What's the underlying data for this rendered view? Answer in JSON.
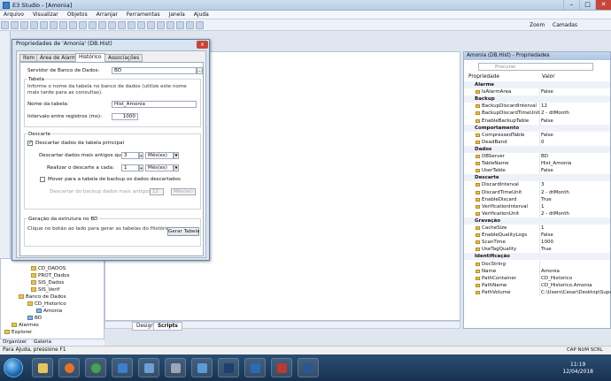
{
  "window": {
    "title": "E3 Studio - [Amonia]"
  },
  "menu": [
    "Arquivo",
    "Visualizar",
    "Objetos",
    "Arranjar",
    "Ferramentas",
    "Janela",
    "Ajuda"
  ],
  "toolbar": {
    "zoom_label": "Zoom",
    "camadas_label": "Camadas"
  },
  "dialog": {
    "title": "Propriedades de 'Amonia' (DB.Hist)",
    "close": "x",
    "tabs": [
      "Item",
      "Área de Alarmes",
      "Histórico",
      "Associações"
    ],
    "server_label": "Servidor de Banco de Dados:",
    "server_value": "BD",
    "browse_btn": "...",
    "tabela_group": "Tabela",
    "tabela_desc": "Informe o nome da tabela no banco de dados (utilize este nome mais tarde para as consultas).",
    "table_name_label": "Nome da tabela:",
    "table_name_value": "Hist_Amonia",
    "interval_label": "Intervalo entre registros (ms):",
    "interval_value": "1000",
    "descarte_group": "Descarte",
    "discard_check": "Descartar dados da tabela principal",
    "discard_older_label": "Descartar dados mais antigos que:",
    "discard_older_value": "3",
    "discard_older_unit": "Mês(es)",
    "discard_each_label": "Realizar o descarte a cada:",
    "discard_each_value": "1",
    "discard_each_unit": "Mês(es)",
    "move_check": "Mover para a tabela de backup os dados descartados",
    "backup_older_label": "Descartar do backup dados mais antigos que:",
    "backup_older_value": "12",
    "backup_older_unit": "Mês(es)",
    "gen_group": "Geração da estrutura no BD",
    "gen_desc": "Clique no botão ao lado para gerar as tabelas do Histórico",
    "gen_btn": "Gerar Tabela"
  },
  "tree": {
    "items": [
      "CD_DADOS",
      "PROT_Dados",
      "SIS_Dados",
      "SIS_Verif",
      "Banco de Dados",
      "CD_Historico",
      "Amonia",
      "BD",
      "Alarmes",
      "Explorer"
    ]
  },
  "left_bottom_tabs": [
    "Organizer",
    "Galeria"
  ],
  "editor_tabs": [
    "Design",
    "Scripts"
  ],
  "properties": {
    "title": "Amonia (DB.Hist) - Propriedades",
    "search_placeholder": "Procurar",
    "col_prop": "Propriedade",
    "col_val": "Valor",
    "rows": [
      {
        "cat": true,
        "name": "Alarme"
      },
      {
        "name": "IsAlarmArea",
        "value": "False"
      },
      {
        "cat": true,
        "name": "Backup"
      },
      {
        "name": "BackupDiscardInterval",
        "value": "12"
      },
      {
        "name": "BackupDiscardTimeUnit",
        "value": "2 - dtMonth"
      },
      {
        "name": "EnableBackupTable",
        "value": "False"
      },
      {
        "cat": true,
        "name": "Comportamento"
      },
      {
        "name": "CompressedTable",
        "value": "False"
      },
      {
        "name": "DeadBand",
        "value": "0"
      },
      {
        "cat": true,
        "name": "Dados"
      },
      {
        "name": "DBServer",
        "value": "BD"
      },
      {
        "name": "TableName",
        "value": "Hist_Amonia"
      },
      {
        "name": "UserTable",
        "value": "False"
      },
      {
        "cat": true,
        "name": "Descarte"
      },
      {
        "name": "DiscardInterval",
        "value": "3"
      },
      {
        "name": "DiscardTimeUnit",
        "value": "2 - dtMonth"
      },
      {
        "name": "EnableDiscard",
        "value": "True"
      },
      {
        "name": "VerificationInterval",
        "value": "1"
      },
      {
        "name": "VerificationUnit",
        "value": "2 - dtMonth"
      },
      {
        "cat": true,
        "name": "Gravação"
      },
      {
        "name": "CacheSize",
        "value": "1"
      },
      {
        "name": "EnableQualityLogs",
        "value": "False"
      },
      {
        "name": "ScanTime",
        "value": "1000"
      },
      {
        "name": "UseTagQuality",
        "value": "True"
      },
      {
        "cat": true,
        "name": "Identificação"
      },
      {
        "name": "DocString",
        "value": ""
      },
      {
        "name": "Name",
        "value": "Amonia"
      },
      {
        "name": "PathContainer",
        "value": "CD_Historico"
      },
      {
        "name": "PathName",
        "value": "CD_Historico.Amonia"
      },
      {
        "name": "PathVolume",
        "value": "C:\\Users\\Cesar\\Desktop\\Super..."
      }
    ]
  },
  "status": {
    "left": "Para Ajuda, pressione F1",
    "right": "CAP  NUM  SCRL"
  },
  "clock": {
    "time": "11:19",
    "date": "12/04/2018"
  }
}
